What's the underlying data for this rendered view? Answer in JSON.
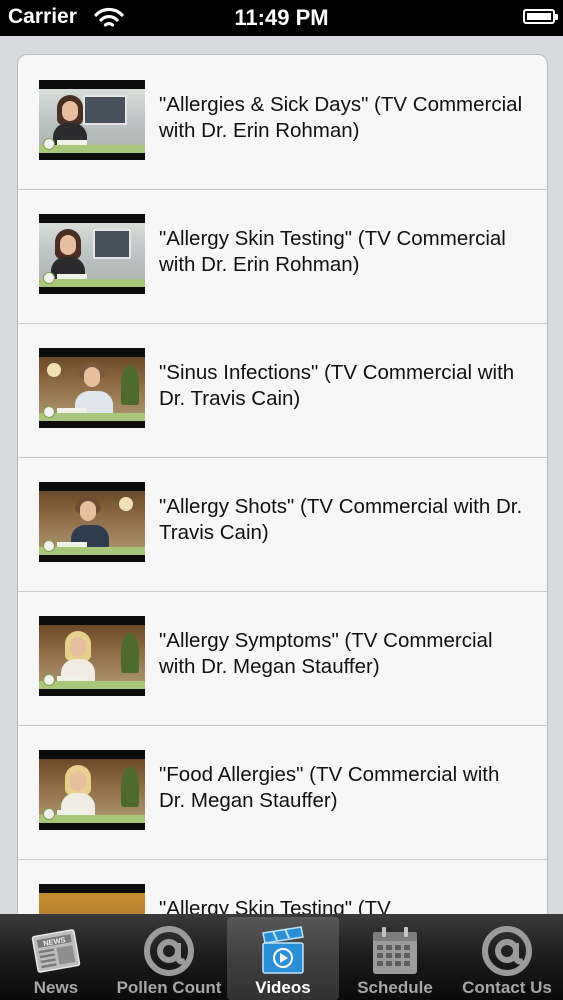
{
  "status_bar": {
    "carrier": "Carrier",
    "time": "11:49 PM"
  },
  "videos": [
    {
      "title": "\"Allergies & Sick Days\" (TV Commercial with Dr. Erin Rohman)"
    },
    {
      "title": "\"Allergy Skin Testing\" (TV Commercial with Dr. Erin Rohman)"
    },
    {
      "title": "\"Sinus Infections\" (TV Commercial with Dr. Travis Cain)"
    },
    {
      "title": "\"Allergy Shots\" (TV Commercial with Dr. Travis Cain)"
    },
    {
      "title": "\"Allergy Symptoms\" (TV Commercial with Dr. Megan Stauffer)"
    },
    {
      "title": "\"Food Allergies\" (TV Commercial with Dr. Megan Stauffer)"
    },
    {
      "title": "\"Allergy Skin Testing\" (TV"
    }
  ],
  "tab_bar": {
    "active_tab": "Videos",
    "tabs": [
      {
        "label": "News",
        "icon": "newspaper-icon"
      },
      {
        "label": "Pollen Count",
        "icon": "at-sign-icon"
      },
      {
        "label": "Videos",
        "icon": "video-clapper-icon"
      },
      {
        "label": "Schedule",
        "icon": "calendar-icon"
      },
      {
        "label": "Contact Us",
        "icon": "at-sign-icon"
      }
    ]
  }
}
